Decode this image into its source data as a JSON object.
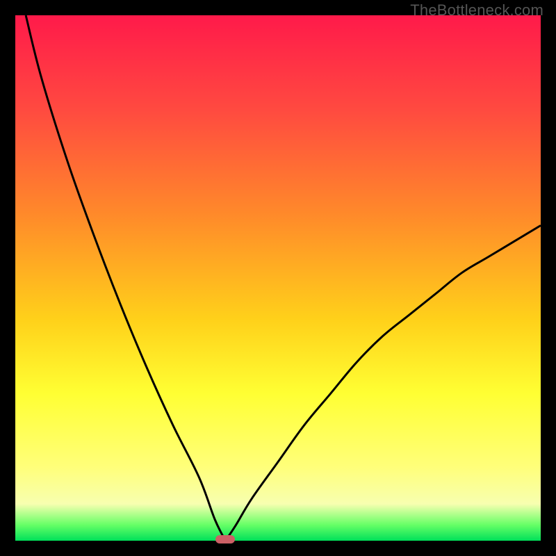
{
  "watermark": "TheBottleneck.com",
  "colors": {
    "background": "#000000",
    "gradient_top": "#ff1a4a",
    "gradient_bottom": "#00e05a",
    "curve": "#000000",
    "marker": "#cc6066"
  },
  "chart_data": {
    "type": "line",
    "title": "",
    "xlabel": "",
    "ylabel": "",
    "xlim": [
      0,
      100
    ],
    "ylim": [
      0,
      100
    ],
    "grid": false,
    "legend": false,
    "annotations": [],
    "watermark": "TheBottleneck.com",
    "minimum": {
      "x": 40,
      "y": 0
    },
    "marker_fraction_x": 0.4,
    "series": [
      {
        "name": "left-branch",
        "x": [
          2,
          5,
          10,
          15,
          20,
          25,
          30,
          35,
          38,
          40
        ],
        "y": [
          100,
          88,
          72,
          58,
          45,
          33,
          22,
          12,
          4,
          0
        ]
      },
      {
        "name": "right-branch",
        "x": [
          40,
          42,
          45,
          50,
          55,
          60,
          65,
          70,
          75,
          80,
          85,
          90,
          95,
          100
        ],
        "y": [
          0,
          3,
          8,
          15,
          22,
          28,
          34,
          39,
          43,
          47,
          51,
          54,
          57,
          60
        ]
      }
    ]
  }
}
